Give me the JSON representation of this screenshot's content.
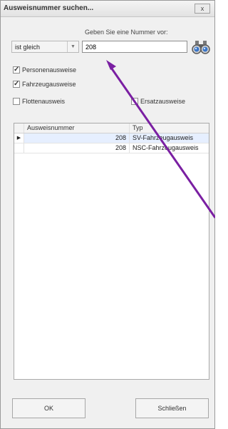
{
  "dialog": {
    "title": "Ausweisnummer suchen...",
    "close_label": "x"
  },
  "search": {
    "prompt": "Geben Sie eine Nummer vor:",
    "operator": "ist gleich",
    "number": "208",
    "search_icon": "binoculars-icon"
  },
  "filters": {
    "personal": {
      "label": "Personenausweise",
      "checked": true
    },
    "vehicle": {
      "label": "Fahrzeugausweise",
      "checked": true
    },
    "fleet": {
      "label": "Flottenausweis",
      "checked": false
    },
    "replacement": {
      "label": "Ersatzausweise",
      "checked": false
    }
  },
  "grid": {
    "columns": [
      "Ausweisnummer",
      "Typ"
    ],
    "rows": [
      {
        "number": "208",
        "type": "SV-Fahrzeugausweis",
        "selected": true
      },
      {
        "number": "208",
        "type": "NSC-Fahrzeugausweis",
        "selected": false
      }
    ]
  },
  "buttons": {
    "ok": "OK",
    "close": "Schließen"
  },
  "annotation": {
    "color": "#7a1fa2"
  }
}
